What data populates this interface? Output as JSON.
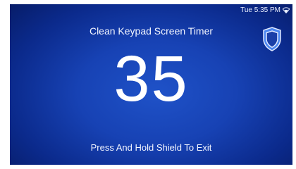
{
  "status_bar": {
    "time": "Tue 5:35 PM",
    "wifi_icon": "wifi-icon"
  },
  "title": "Clean Keypad Screen Timer",
  "countdown": "35",
  "hint": "Press And Hold Shield To Exit",
  "shield_icon": "shield-icon",
  "colors": {
    "background": "#1742b4",
    "text": "#ffffff",
    "shield_fill": "#4a86f0"
  }
}
